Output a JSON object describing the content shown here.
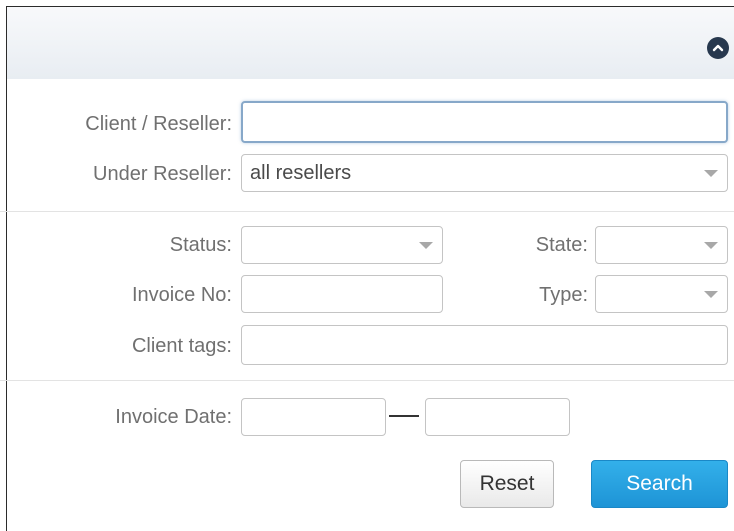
{
  "header": {
    "collapse_icon": "chevron-up-icon"
  },
  "filters": {
    "client_reseller": {
      "label": "Client / Reseller:",
      "value": ""
    },
    "under_reseller": {
      "label": "Under Reseller:",
      "value": "all resellers"
    },
    "status": {
      "label": "Status:",
      "value": ""
    },
    "state": {
      "label": "State:",
      "value": ""
    },
    "invoice_no": {
      "label": "Invoice No:",
      "value": ""
    },
    "type": {
      "label": "Type:",
      "value": ""
    },
    "client_tags": {
      "label": "Client tags:",
      "value": ""
    },
    "invoice_date": {
      "label": "Invoice Date:",
      "from": "",
      "to": ""
    }
  },
  "actions": {
    "reset_label": "Reset",
    "search_label": "Search"
  },
  "colors": {
    "accent": "#1e94d6",
    "header_icon": "#27384e"
  }
}
